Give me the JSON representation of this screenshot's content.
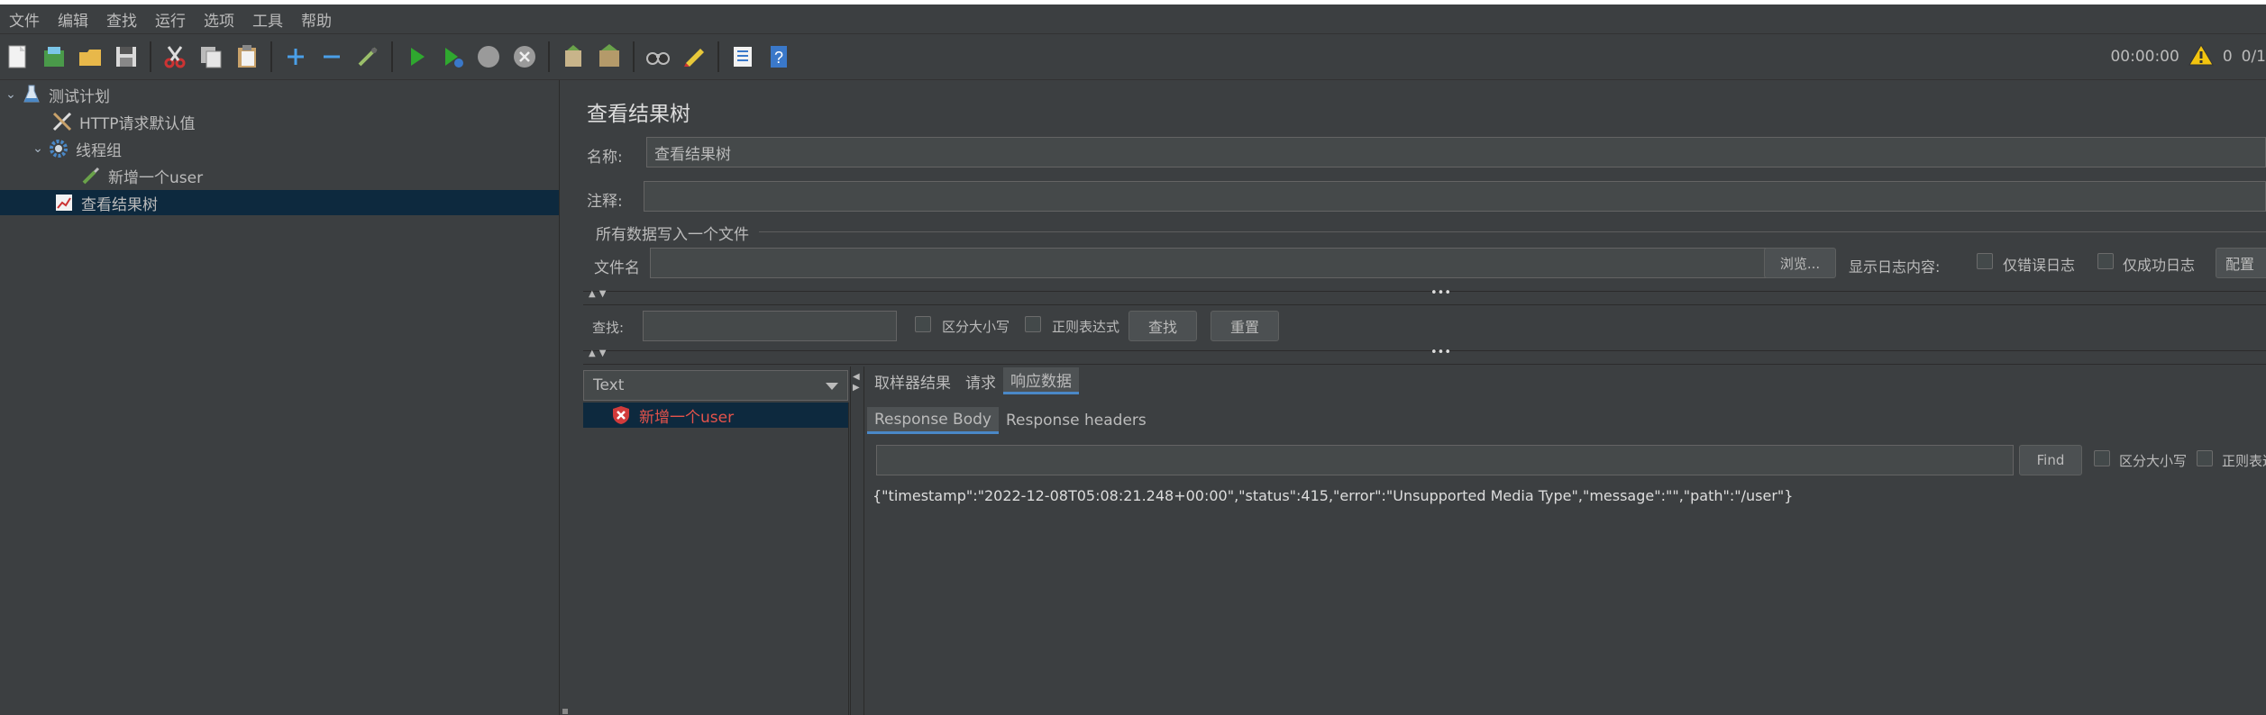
{
  "menubar": {
    "items": [
      "文件",
      "编辑",
      "查找",
      "运行",
      "选项",
      "工具",
      "帮助"
    ]
  },
  "toolbar": {
    "icons": [
      "new-plan-icon",
      "templates-icon",
      "open-icon",
      "save-icon",
      "cut-icon",
      "copy-icon",
      "paste-icon",
      "expand-icon",
      "collapse-icon",
      "toggle-icon",
      "start-icon",
      "start-no-pause-icon",
      "stop-icon",
      "shutdown-icon",
      "clear-icon",
      "clear-all-icon",
      "search-icon",
      "reset-search-icon",
      "function-helper-icon",
      "help-icon"
    ],
    "timer": "00:00:00",
    "warnings_count": "0",
    "threads": "0/1"
  },
  "tree": {
    "items": [
      {
        "label": "测试计划",
        "icon": "flask-icon",
        "expanded": true
      },
      {
        "label": "HTTP请求默认值",
        "icon": "tools-icon"
      },
      {
        "label": "线程组",
        "icon": "gear-icon",
        "expanded": true
      },
      {
        "label": "新增一个user",
        "icon": "pipette-icon"
      },
      {
        "label": "查看结果树",
        "icon": "graph-icon",
        "selected": true
      }
    ]
  },
  "panel": {
    "title": "查看结果树",
    "name_label": "名称:",
    "name_value": "查看结果树",
    "comment_label": "注释:",
    "comment_value": "",
    "write_group_label": "所有数据写入一个文件",
    "filename_label": "文件名",
    "filename_value": "",
    "browse_label": "浏览...",
    "log_display_label": "显示日志内容:",
    "errors_only_label": "仅错误日志",
    "success_only_label": "仅成功日志",
    "configure_label": "配置"
  },
  "search": {
    "label": "查找:",
    "value": "",
    "case_label": "区分大小写",
    "regex_label": "正则表达式",
    "find_label": "查找",
    "reset_label": "重置"
  },
  "results": {
    "renderer": "Text",
    "samples": [
      {
        "label": "新增一个user",
        "status": "error"
      }
    ],
    "tabs": [
      "取样器结果",
      "请求",
      "响应数据"
    ],
    "active_tab": "响应数据",
    "subtabs": [
      "Response Body",
      "Response headers"
    ],
    "active_subtab": "Response Body",
    "find_value": "",
    "find_label": "Find",
    "case_label": "区分大小写",
    "regex_label": "正则表达",
    "body": "{\"timestamp\":\"2022-12-08T05:08:21.248+00:00\",\"status\":415,\"error\":\"Unsupported Media Type\",\"message\":\"\",\"path\":\"/user\"}"
  },
  "colors": {
    "background": "#3c3f41",
    "selection": "#0d293e",
    "error_text": "#e5534b",
    "accent": "#4a88c7"
  }
}
